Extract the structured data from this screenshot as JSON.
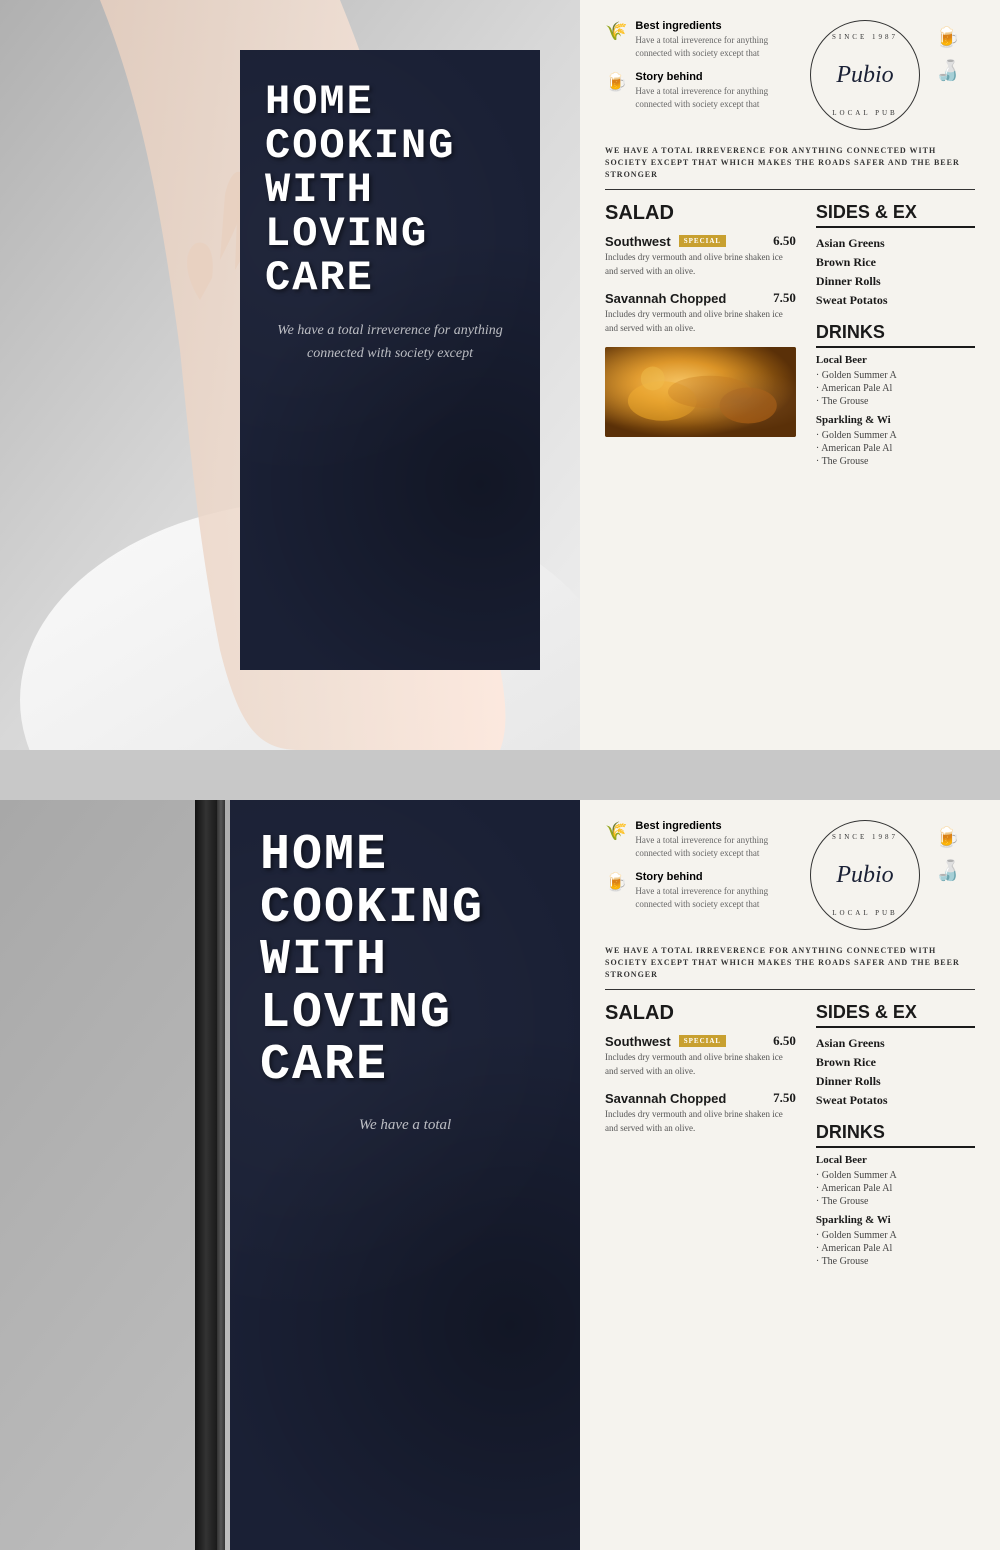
{
  "section1": {
    "menu_card": {
      "title_line1": "HOME",
      "title_line2": "COOKING",
      "title_line3": "WITH",
      "title_line4": "LOVING",
      "title_line5": "CARE",
      "subtitle": "We have a total irreverence for anything connected with society except"
    },
    "header": {
      "since": "SINCE 1987",
      "logo_name": "Pubio",
      "local_pub": "LOCAL PUB",
      "feature1_title": "Best ingredients",
      "feature1_desc": "Have a total irreverence for anything connected with society except that",
      "feature2_title": "Story behind",
      "feature2_desc": "Have a total irreverence for anything connected with society except that"
    },
    "tagline": "WE HAVE A TOTAL IRREVERENCE FOR ANYTHING CONNECTED WITH SOCIETY EXCEPT THAT WHICH MAKES THE ROADS SAFER AND THE BEER STRONGER",
    "salad_section": {
      "title": "SALAD",
      "items": [
        {
          "name": "Southwest",
          "badge": "SPECIAL",
          "price": "6.50",
          "desc": "Includes dry vermouth and olive brine shaken ice and served with an olive."
        },
        {
          "name": "Savannah Chopped",
          "price": "7.50",
          "desc": "Includes dry vermouth and olive brine shaken ice and served with an olive."
        }
      ]
    },
    "sides_section": {
      "title": "SIDES & EX",
      "items": [
        "Asian Greens",
        "Brown Rice",
        "Dinner Rolls",
        "Sweat Potatos"
      ]
    },
    "drinks_section": {
      "title": "DRINKS",
      "categories": [
        {
          "name": "Local Beer",
          "items": [
            "Golden Summer A",
            "American Pale Al",
            "The Grouse"
          ]
        },
        {
          "name": "Sparkling & Wi",
          "items": [
            "Golden Summer A",
            "American Pale Al",
            "The Grouse"
          ]
        }
      ]
    }
  },
  "section2": {
    "menu_card": {
      "title_line1": "HOME",
      "title_line2": "COOKING",
      "title_line3": "WITH",
      "title_line4": "LOVING",
      "title_line5": "CARE",
      "subtitle": "We have a total"
    },
    "header": {
      "since": "SINCE 1987",
      "logo_name": "Pubio",
      "local_pub": "LOCAL PUB",
      "feature1_title": "Best ingredients",
      "feature1_desc": "Have a total irreverence for anything connected with society except that",
      "feature2_title": "Story behind",
      "feature2_desc": "Have a total irreverence for anything connected with society except that"
    },
    "tagline": "WE HAVE A TOTAL IRREVERENCE FOR ANYTHING CONNECTED WITH SOCIETY EXCEPT THAT WHICH MAKES THE ROADS SAFER AND THE BEER STRONGER",
    "salad_section": {
      "title": "SALAD",
      "items": [
        {
          "name": "Southwest",
          "badge": "SPECIAL",
          "price": "6.50",
          "desc": "Includes dry vermouth and olive brine shaken ice and served with an olive."
        },
        {
          "name": "Savannah Chopped",
          "price": "7.50",
          "desc": "Includes dry vermouth and olive brine shaken ice and served with an olive."
        }
      ]
    },
    "sides_section": {
      "title": "SIDES & EX",
      "items": [
        "Asian Greens",
        "Brown Rice",
        "Dinner Rolls",
        "Sweat Potatos"
      ]
    },
    "drinks_section": {
      "title": "DRINKS",
      "categories": [
        {
          "name": "Local Beer",
          "items": [
            "Golden Summer A",
            "American Pale Al",
            "The Grouse"
          ]
        },
        {
          "name": "Sparkling & Wi",
          "items": [
            "Golden Summer A",
            "American Pale Al",
            "The Grouse"
          ]
        }
      ]
    }
  }
}
